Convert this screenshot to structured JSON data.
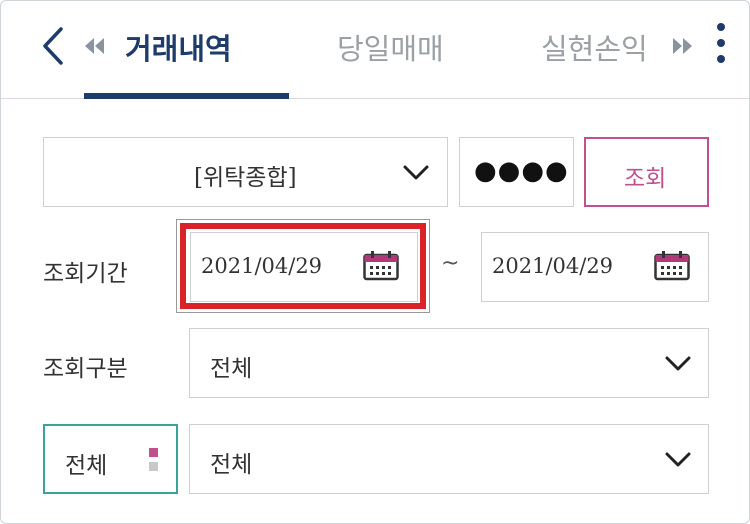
{
  "header": {
    "tabs": [
      {
        "label": "거래내역",
        "active": true
      },
      {
        "label": "당일매매",
        "active": false
      },
      {
        "label": "실현손익",
        "active": false
      }
    ]
  },
  "form": {
    "account_type": "[위탁종합]",
    "password_mask": "●●●●",
    "search_button": "조회",
    "period_label": "조회기간",
    "start_date": "2021/04/29",
    "range_separator": "~",
    "end_date": "2021/04/29",
    "type_label": "조회구분",
    "type_value": "전체",
    "filter_left_value": "전체",
    "filter_right_value": "전체"
  },
  "colors": {
    "primary": "#1d3c6b",
    "accent_pink": "#c0508f",
    "highlight_red": "#d9222a",
    "teal": "#3aa39a",
    "calendar": "#b0397a"
  }
}
